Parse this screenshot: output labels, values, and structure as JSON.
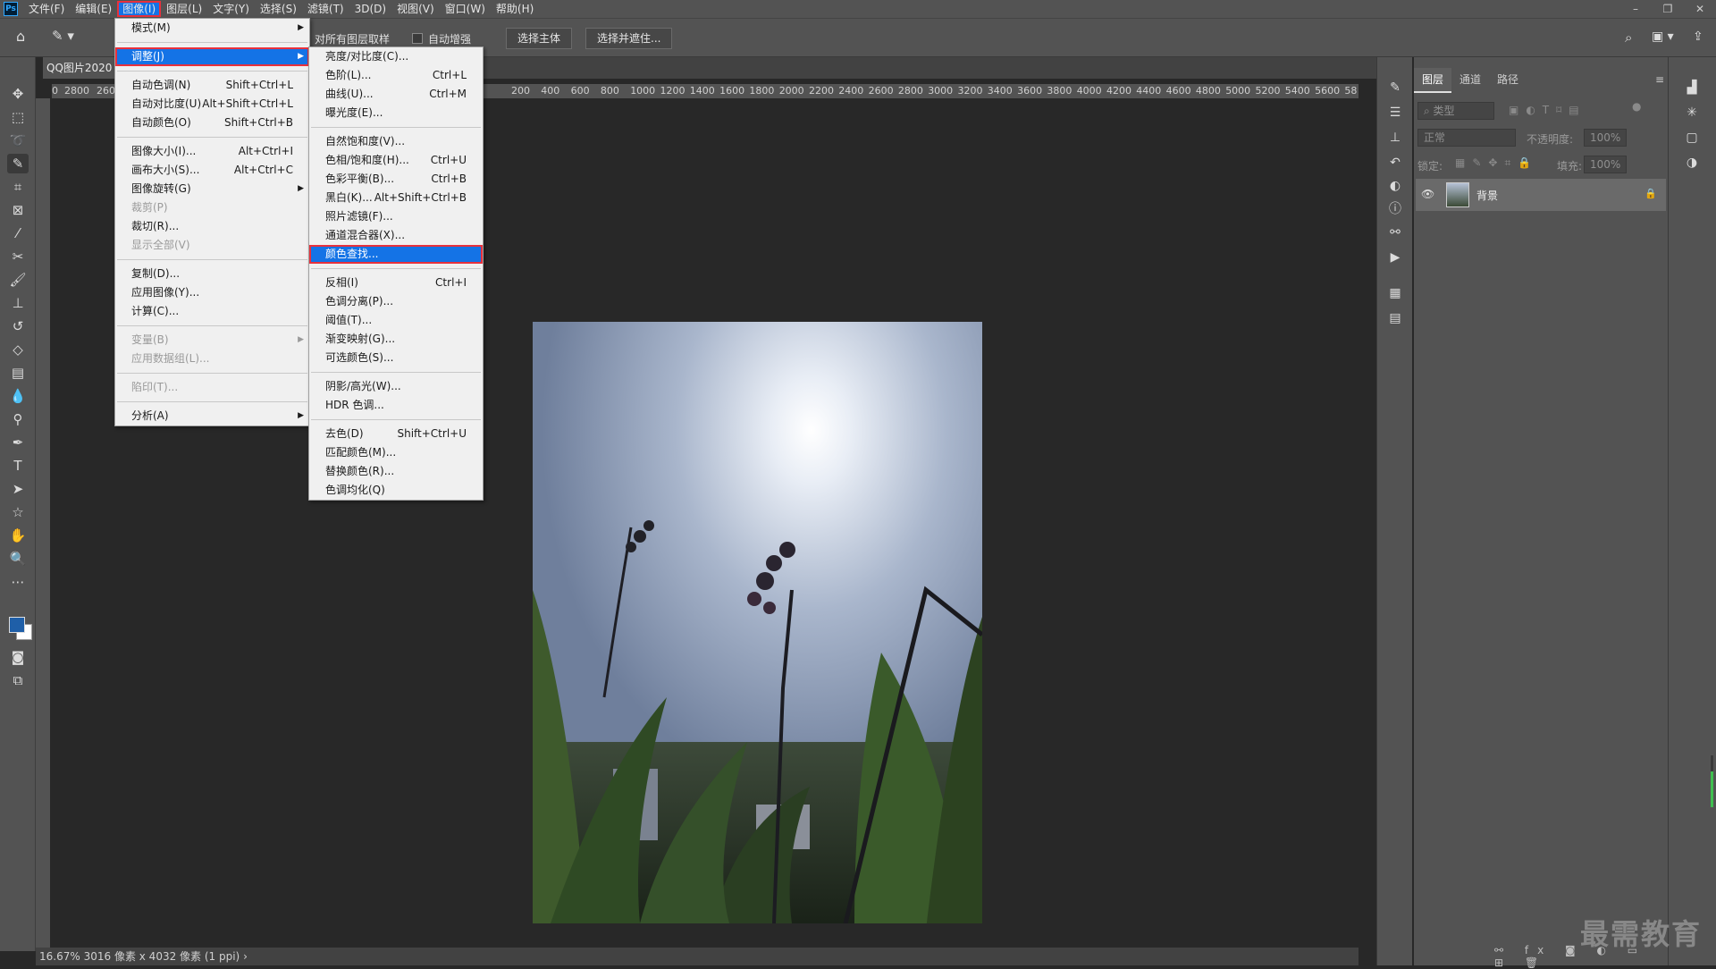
{
  "app": {
    "logo": "Ps"
  },
  "menubar": {
    "items": [
      "文件(F)",
      "编辑(E)",
      "图像(I)",
      "图层(L)",
      "文字(Y)",
      "选择(S)",
      "滤镜(T)",
      "3D(D)",
      "视图(V)",
      "窗口(W)",
      "帮助(H)"
    ],
    "window_controls": [
      "–",
      "❐",
      "✕"
    ]
  },
  "options_bar": {
    "sample_all_layers": "对所有图层取样",
    "auto_enhance": "自动增强",
    "select_subject": "选择主体",
    "select_and_mask": "选择并遮住..."
  },
  "document": {
    "tab_title": "QQ图片2020"
  },
  "ruler": {
    "h_labels_left": [
      "0",
      "2800",
      "260"
    ],
    "h_labels": [
      "200",
      "400",
      "600",
      "800",
      "1000",
      "1200",
      "1400",
      "1600",
      "1800",
      "2000",
      "2200",
      "2400",
      "2600",
      "2800",
      "3000",
      "3200",
      "3400",
      "3600",
      "3800",
      "4000",
      "4200",
      "4400",
      "4600",
      "4800",
      "5000",
      "5200",
      "5400",
      "5600",
      "58"
    ]
  },
  "status": {
    "zoom": "16.67%",
    "info": "3016 像素 x 4032 像素 (1 ppi)",
    "chevron": "›"
  },
  "image_menu": {
    "items": [
      {
        "label": "模式(M)",
        "shortcut": "",
        "submenu": true,
        "disabled": false
      },
      {
        "sep": true
      },
      {
        "label": "调整(J)",
        "shortcut": "",
        "submenu": true,
        "disabled": false,
        "highlight": true
      },
      {
        "sep": true
      },
      {
        "label": "自动色调(N)",
        "shortcut": "Shift+Ctrl+L",
        "disabled": false
      },
      {
        "label": "自动对比度(U)",
        "shortcut": "Alt+Shift+Ctrl+L",
        "disabled": false
      },
      {
        "label": "自动颜色(O)",
        "shortcut": "Shift+Ctrl+B",
        "disabled": false
      },
      {
        "sep": true
      },
      {
        "label": "图像大小(I)...",
        "shortcut": "Alt+Ctrl+I",
        "disabled": false
      },
      {
        "label": "画布大小(S)...",
        "shortcut": "Alt+Ctrl+C",
        "disabled": false
      },
      {
        "label": "图像旋转(G)",
        "shortcut": "",
        "submenu": true,
        "disabled": false
      },
      {
        "label": "裁剪(P)",
        "shortcut": "",
        "disabled": true
      },
      {
        "label": "裁切(R)...",
        "shortcut": "",
        "disabled": false
      },
      {
        "label": "显示全部(V)",
        "shortcut": "",
        "disabled": true
      },
      {
        "sep": true
      },
      {
        "label": "复制(D)...",
        "shortcut": "",
        "disabled": false
      },
      {
        "label": "应用图像(Y)...",
        "shortcut": "",
        "disabled": false
      },
      {
        "label": "计算(C)...",
        "shortcut": "",
        "disabled": false
      },
      {
        "sep": true
      },
      {
        "label": "变量(B)",
        "shortcut": "",
        "submenu": true,
        "disabled": true
      },
      {
        "label": "应用数据组(L)...",
        "shortcut": "",
        "disabled": true
      },
      {
        "sep": true
      },
      {
        "label": "陷印(T)...",
        "shortcut": "",
        "disabled": true
      },
      {
        "sep": true
      },
      {
        "label": "分析(A)",
        "shortcut": "",
        "submenu": true,
        "disabled": false
      }
    ]
  },
  "adjust_menu": {
    "items": [
      {
        "label": "亮度/对比度(C)...",
        "shortcut": ""
      },
      {
        "label": "色阶(L)...",
        "shortcut": "Ctrl+L"
      },
      {
        "label": "曲线(U)...",
        "shortcut": "Ctrl+M"
      },
      {
        "label": "曝光度(E)...",
        "shortcut": ""
      },
      {
        "sep": true
      },
      {
        "label": "自然饱和度(V)...",
        "shortcut": ""
      },
      {
        "label": "色相/饱和度(H)...",
        "shortcut": "Ctrl+U"
      },
      {
        "label": "色彩平衡(B)...",
        "shortcut": "Ctrl+B"
      },
      {
        "label": "黑白(K)...",
        "shortcut": "Alt+Shift+Ctrl+B"
      },
      {
        "label": "照片滤镜(F)...",
        "shortcut": ""
      },
      {
        "label": "通道混合器(X)...",
        "shortcut": ""
      },
      {
        "label": "颜色查找...",
        "shortcut": "",
        "highlight": true
      },
      {
        "sep": true
      },
      {
        "label": "反相(I)",
        "shortcut": "Ctrl+I"
      },
      {
        "label": "色调分离(P)...",
        "shortcut": ""
      },
      {
        "label": "阈值(T)...",
        "shortcut": ""
      },
      {
        "label": "渐变映射(G)...",
        "shortcut": ""
      },
      {
        "label": "可选颜色(S)...",
        "shortcut": ""
      },
      {
        "sep": true
      },
      {
        "label": "阴影/高光(W)...",
        "shortcut": ""
      },
      {
        "label": "HDR 色调...",
        "shortcut": ""
      },
      {
        "sep": true
      },
      {
        "label": "去色(D)",
        "shortcut": "Shift+Ctrl+U"
      },
      {
        "label": "匹配颜色(M)...",
        "shortcut": ""
      },
      {
        "label": "替换颜色(R)...",
        "shortcut": ""
      },
      {
        "label": "色调均化(Q)",
        "shortcut": ""
      }
    ]
  },
  "layers_panel": {
    "tabs": [
      "图层",
      "通道",
      "路径"
    ],
    "filter_placeholder": "类型",
    "blend_mode": "正常",
    "opacity_label": "不透明度:",
    "opacity_value": "100%",
    "lock_label": "锁定:",
    "fill_label": "填充:",
    "fill_value": "100%",
    "layer_name": "背景"
  },
  "watermark": "最需教育",
  "colors": {
    "menu_highlight": "#1473e6",
    "red_outline": "#e8313c",
    "foreground_swatch": "#1f5fa8",
    "background_swatch": "#ffffff"
  }
}
